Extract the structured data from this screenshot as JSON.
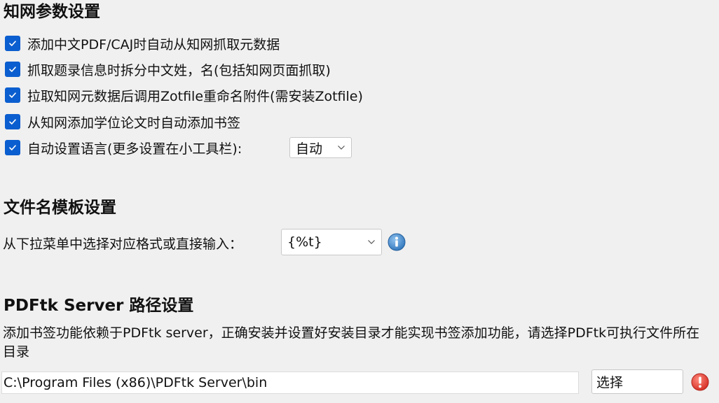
{
  "cnki_section": {
    "title": "知网参数设置",
    "checkboxes": [
      {
        "label": "添加中文PDF/CAJ时自动从知网抓取元数据",
        "checked": true
      },
      {
        "label": "抓取题录信息时拆分中文姓，名(包括知网页面抓取)",
        "checked": true
      },
      {
        "label": "拉取知网元数据后调用Zotfile重命名附件(需安装Zotfile)",
        "checked": true
      },
      {
        "label": "从知网添加学位论文时自动添加书签",
        "checked": true
      },
      {
        "label": "自动设置语言(更多设置在小工具栏):",
        "checked": true
      }
    ],
    "language_select": {
      "value": "自动"
    }
  },
  "filename_section": {
    "title": "文件名模板设置",
    "prompt": "从下拉菜单中选择对应格式或直接输入：",
    "template_select": {
      "value": "{%t}"
    }
  },
  "pdftk_section": {
    "title": "PDFtk Server 路径设置",
    "description": "添加书签功能依赖于PDFtk server，正确安装并设置好安装目录才能实现书签添加功能，请选择PDFtk可执行文件所在目录",
    "path_value": "C:\\Program Files (x86)\\PDFtk Server\\bin",
    "choose_button": "选择"
  },
  "colors": {
    "checkbox": "#0b5ecf",
    "info_icon": "#3a84c9",
    "error_icon": "#e2382f",
    "background": "#f0f0f0"
  },
  "icons": {
    "check": "check-icon",
    "info": "info-icon",
    "error": "error-icon",
    "dropdown": "chevron-down-icon"
  }
}
